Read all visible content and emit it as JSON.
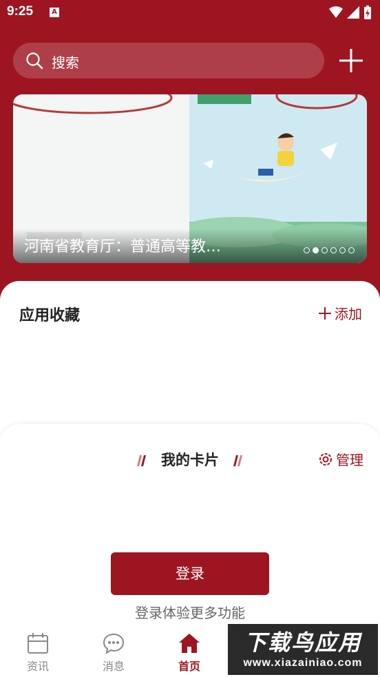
{
  "statusbar": {
    "time": "9:25",
    "badge": "A"
  },
  "search": {
    "placeholder": "搜索"
  },
  "banner": {
    "title": "河南省教育厅：普通高等教…",
    "dots_total": 6,
    "dots_active": 2
  },
  "favorites": {
    "title": "应用收藏",
    "add_label": "添加"
  },
  "cards": {
    "title": "我的卡片",
    "manage_label": "管理",
    "login_label": "登录",
    "login_hint": "登录体验更多功能"
  },
  "tabs": [
    {
      "label": "资讯",
      "icon": "calendar-icon",
      "active": false
    },
    {
      "label": "消息",
      "icon": "chat-icon",
      "active": false
    },
    {
      "label": "首页",
      "icon": "home-icon",
      "active": true
    }
  ],
  "watermark": {
    "main": "下载鸟应用",
    "sub": "www.xiazainiao.com"
  },
  "colors": {
    "brand": "#9d1521"
  }
}
